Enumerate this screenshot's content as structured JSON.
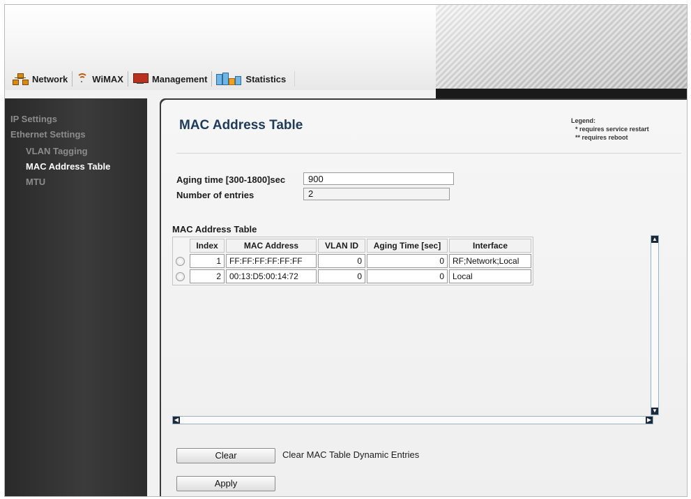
{
  "nav": {
    "tabs": [
      {
        "label": "Network",
        "icon": "network-icon"
      },
      {
        "label": "WiMAX",
        "icon": "wifi-icon"
      },
      {
        "label": "Management",
        "icon": "monitor-icon"
      },
      {
        "label": "Statistics",
        "icon": "chart-icon"
      }
    ]
  },
  "sidebar": {
    "items": [
      {
        "label": "IP Settings",
        "level": 0
      },
      {
        "label": "Ethernet Settings",
        "level": 0
      },
      {
        "label": "VLAN Tagging",
        "level": 1
      },
      {
        "label": "MAC Address Table",
        "level": 1,
        "active": true
      },
      {
        "label": "MTU",
        "level": 1
      }
    ]
  },
  "page": {
    "title": "MAC Address Table",
    "legend": {
      "title": "Legend:",
      "restart_marker": "*",
      "restart": "requires service restart",
      "reboot_marker": "**",
      "reboot": "requires reboot"
    }
  },
  "form": {
    "aging_label": "Aging time [300-1800]sec",
    "aging_value": "900",
    "entries_label": "Number of entries",
    "entries_value": "2"
  },
  "table": {
    "title": "MAC Address Table",
    "columns": [
      "Index",
      "MAC Address",
      "VLAN ID",
      "Aging Time [sec]",
      "Interface"
    ],
    "rows": [
      {
        "index": "1",
        "mac": "FF:FF:FF:FF:FF:FF",
        "vlan": "0",
        "aging": "0",
        "interface": "RF;Network;Local"
      },
      {
        "index": "2",
        "mac": "00:13:D5:00:14:72",
        "vlan": "0",
        "aging": "0",
        "interface": "Local"
      }
    ]
  },
  "actions": {
    "clear_label": "Clear",
    "clear_description": "Clear MAC Table Dynamic Entries",
    "apply_label": "Apply"
  },
  "colors": {
    "title": "#1f3b5a",
    "sidebar_bg": "#333333",
    "sidebar_active": "#ffffff",
    "sidebar_inactive": "#8c8c8c"
  }
}
